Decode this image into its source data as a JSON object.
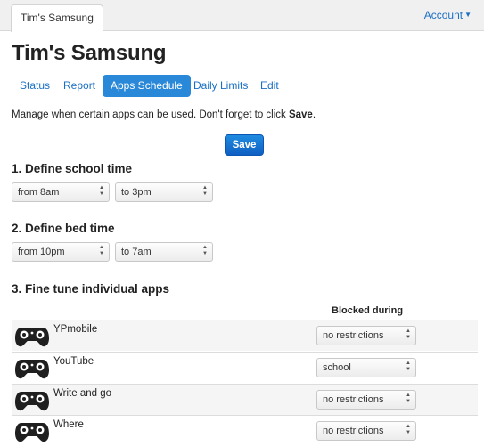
{
  "topbar": {
    "device_tab": "Tim's Samsung",
    "account": "Account"
  },
  "page_title": "Tim's Samsung",
  "nav": {
    "tabs": [
      "Status",
      "Report",
      "Apps Schedule",
      "Daily Limits",
      "Edit"
    ],
    "active": "Apps Schedule"
  },
  "intro": {
    "text": "Manage when certain apps can be used. Don't forget to click ",
    "bold": "Save",
    "end": "."
  },
  "save_label": "Save",
  "school": {
    "heading": "1. Define school time",
    "from": "from 8am",
    "to": "to 3pm"
  },
  "bed": {
    "heading": "2. Define bed time",
    "from": "from 10pm",
    "to": "to 7am"
  },
  "apps": {
    "heading": "3. Fine tune individual apps",
    "blocked_header": "Blocked during",
    "rows": [
      {
        "name": "YPmobile",
        "blocked": "no restrictions",
        "icon": "game-controller-icon"
      },
      {
        "name": "YouTube",
        "blocked": "school",
        "icon": "game-controller-icon"
      },
      {
        "name": "Write and go",
        "blocked": "no restrictions",
        "icon": "game-controller-icon"
      },
      {
        "name": "Where",
        "blocked": "no restrictions",
        "icon": "game-controller-icon"
      }
    ]
  },
  "colors": {
    "link": "#1a6fc4",
    "active_pill": "#2a88d8",
    "save_button": "#1570d2"
  }
}
